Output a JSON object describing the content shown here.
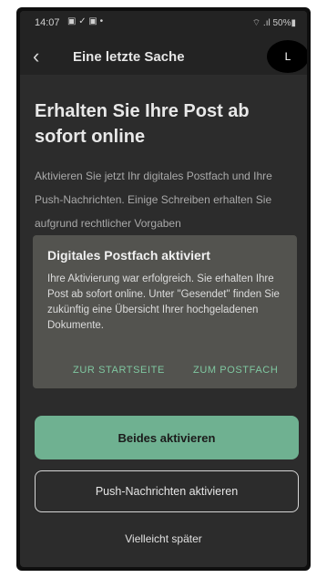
{
  "status_bar": {
    "time": "14:07",
    "left_icons": "▣ ✓ ▣ •",
    "right_text": "⌔ .ıl 50%▮"
  },
  "app_bar": {
    "back_icon": "‹",
    "title": "Eine letzte Sache",
    "avatar_initial": "L"
  },
  "content": {
    "heading": "Erhalten Sie Ihre Post ab sofort online",
    "body": "Aktivieren Sie jetzt Ihr digitales Postfach und Ihre Push-Nachrichten. Einige Schreiben erhalten Sie aufgrund rechtlicher Vorgaben"
  },
  "dialog": {
    "title": "Digitales Postfach aktiviert",
    "text": "Ihre Aktivierung war erfolgreich. Sie erhalten Ihre Post ab sofort online. Unter \"Gesendet\" finden Sie zukünftig eine Übersicht Ihrer hochgeladenen Dokumente.",
    "action_home": "ZUR STARTSEITE",
    "action_postfach": "ZUM POSTFACH"
  },
  "actions": {
    "primary": "Beides aktivieren",
    "secondary": "Push-Nachrichten aktivieren",
    "later": "Vielleicht später"
  },
  "colors": {
    "background": "#2c2c2c",
    "dialog": "#53534f",
    "accent": "#6fb191",
    "dialog_action": "#7fc7a0"
  }
}
